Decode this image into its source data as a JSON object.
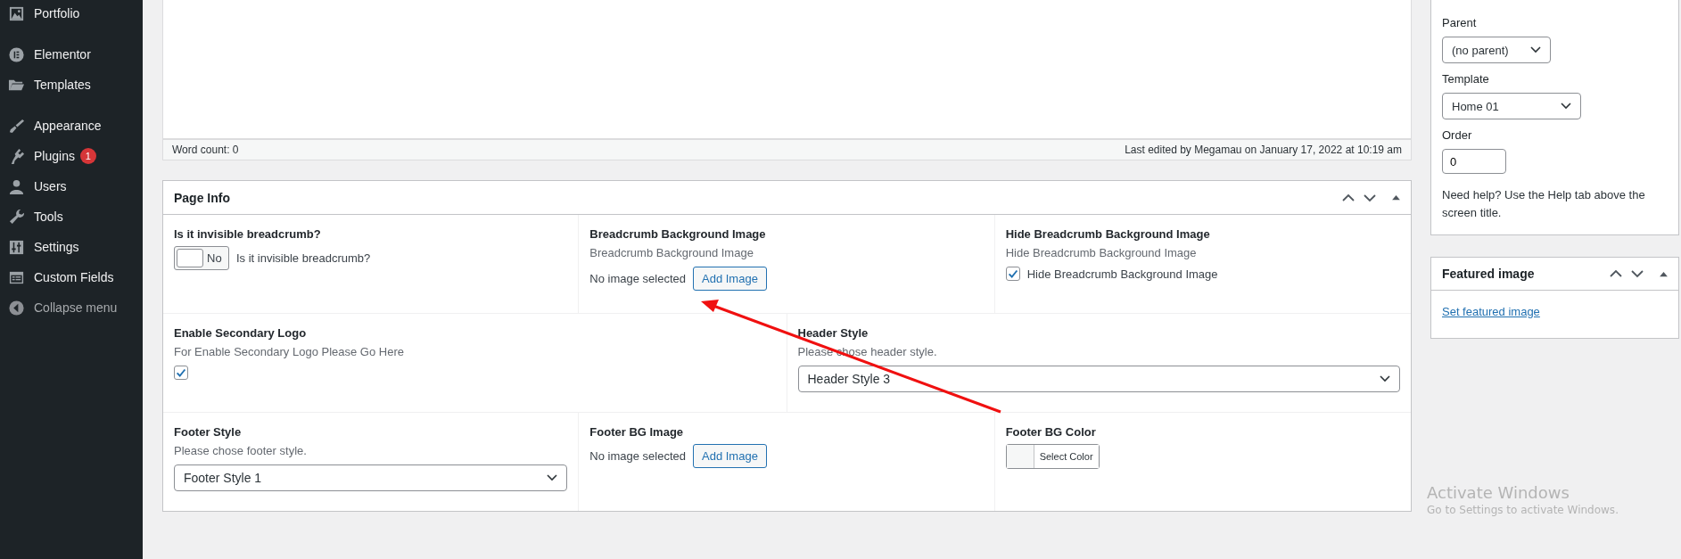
{
  "sidebar": {
    "groups": [
      [
        {
          "label": "Portfolio"
        }
      ],
      [
        {
          "label": "Elementor"
        },
        {
          "label": "Templates"
        }
      ],
      [
        {
          "label": "Appearance"
        },
        {
          "label": "Plugins",
          "badge": "1"
        },
        {
          "label": "Users"
        },
        {
          "label": "Tools"
        },
        {
          "label": "Settings"
        },
        {
          "label": "Custom Fields"
        }
      ]
    ],
    "collapse_label": "Collapse menu"
  },
  "editor": {
    "word_count": "Word count: 0",
    "last_edited": "Last edited by Megamau on January 17, 2022 at 10:19 am"
  },
  "page_info": {
    "title": "Page Info",
    "rows": [
      {
        "fields": [
          {
            "kind": "toggle",
            "label": "Is it invisible breadcrumb?",
            "on": false,
            "toggle_text": "No",
            "caption": "Is it invisible breadcrumb?"
          },
          {
            "kind": "image",
            "label": "Breadcrumb Background Image",
            "description": "Breadcrumb Background Image",
            "status": "No image selected",
            "button": "Add Image"
          },
          {
            "kind": "checkbox",
            "label": "Hide Breadcrumb Background Image",
            "description": "Hide Breadcrumb Background Image",
            "checked": true,
            "checkbox_label": "Hide Breadcrumb Background Image"
          }
        ]
      },
      {
        "fields": [
          {
            "kind": "checkbox",
            "label": "Enable Secondary Logo",
            "description": "For Enable Secondary Logo Please Go Here",
            "checked": true
          },
          {
            "kind": "select",
            "label": "Header Style",
            "description": "Please chose header style.",
            "value": "Header Style 3"
          }
        ]
      },
      {
        "fields": [
          {
            "kind": "select",
            "label": "Footer Style",
            "description": "Please chose footer style.",
            "value": "Footer Style 1"
          },
          {
            "kind": "image",
            "label": "Footer BG Image",
            "status": "No image selected",
            "button": "Add Image"
          },
          {
            "kind": "color",
            "label": "Footer BG Color",
            "button": "Select Color"
          }
        ]
      }
    ]
  },
  "page_attributes": {
    "parent_label": "Parent",
    "parent_value": "(no parent)",
    "template_label": "Template",
    "template_value": "Home 01",
    "order_label": "Order",
    "order_value": "0",
    "help": "Need help? Use the Help tab above the screen title."
  },
  "featured_image": {
    "title": "Featured image",
    "link": "Set featured image"
  },
  "activation_notice": {
    "title": "Activate Windows",
    "subtitle": "Go to Settings to activate Windows."
  }
}
